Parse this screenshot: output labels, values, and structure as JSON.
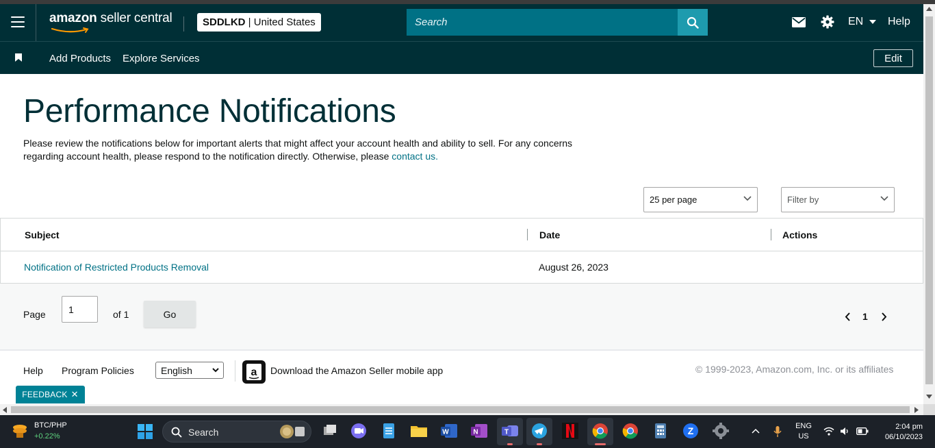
{
  "header": {
    "logo_regular": "amazon",
    "logo_bold": "seller central",
    "account_code": "SDDLKD",
    "account_sep": " | ",
    "account_region": "United States",
    "search_placeholder": "Search",
    "language": "EN",
    "help": "Help",
    "colors": {
      "bg": "#002f36",
      "search": "#007185",
      "search_btn": "#1e9bae"
    }
  },
  "subnav": {
    "items": [
      "Add Products",
      "Explore Services"
    ],
    "edit_label": "Edit"
  },
  "main": {
    "title": "Performance Notifications",
    "intro_text": "Please review the notifications below for important alerts that might affect your account health and ability to sell. For any concerns regarding account health, please respond to the notification directly. Otherwise, please ",
    "intro_link": "contact us.",
    "per_page": "25 per page",
    "filter_placeholder": "Filter by"
  },
  "table": {
    "headers": [
      "Subject",
      "Date",
      "Actions"
    ],
    "rows": [
      {
        "subject": "Notification of Restricted Products Removal",
        "date": "August 26, 2023",
        "actions": ""
      }
    ]
  },
  "pagination": {
    "page_label": "Page",
    "page_value": "1",
    "of_label": "of 1",
    "go_label": "Go",
    "current_page": "1"
  },
  "footer": {
    "links": [
      "Help",
      "Program Policies"
    ],
    "language_select": "English",
    "app_text": "Download the Amazon Seller mobile app",
    "copyright": "© 1999-2023, Amazon.com, Inc. or its affiliates",
    "feedback": "FEEDBACK"
  },
  "taskbar": {
    "ticker_name": "BTC/PHP",
    "ticker_change": "+0.22%",
    "search": "Search",
    "lang_top": "ENG",
    "lang_bottom": "US",
    "time": "2:04 pm",
    "date": "06/10/2023",
    "apps": [
      "windows-start",
      "task-view",
      "zoom-meet",
      "notepad",
      "file-explorer",
      "word",
      "onenote",
      "teams",
      "telegram",
      "netflix",
      "chrome",
      "chrome-alt",
      "calculator",
      "zoom",
      "settings"
    ]
  }
}
